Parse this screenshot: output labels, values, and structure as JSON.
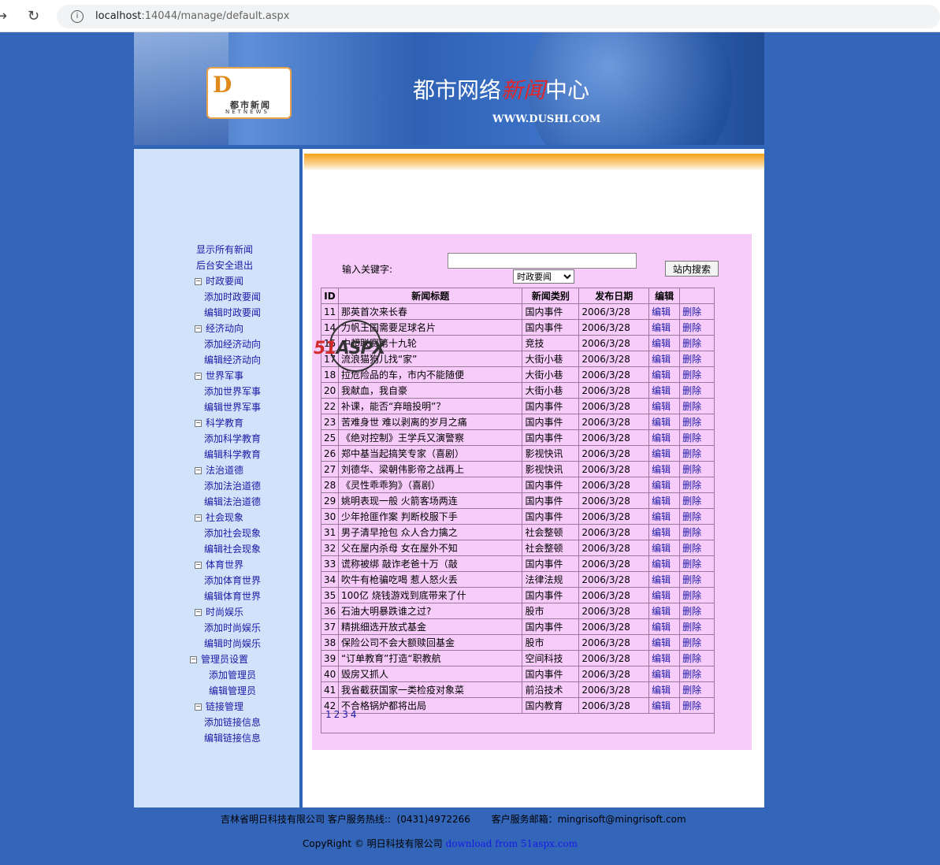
{
  "browser": {
    "url_host": "localhost",
    "url_rest": ":14044/manage/default.aspx"
  },
  "banner": {
    "logo_mark": "D",
    "logo_cn": "都市新闻",
    "logo_en": "NETNEWS",
    "title_a": "都市网络",
    "title_red": "新闻",
    "title_b": "中心",
    "site_url": "WWW.DUSHI.COM"
  },
  "sidebar": {
    "items": [
      {
        "type": "root",
        "label": "显示所有新闻"
      },
      {
        "type": "root",
        "label": "后台安全退出"
      },
      {
        "type": "group",
        "label": "时政要闻"
      },
      {
        "type": "sub",
        "label": "添加时政要闻"
      },
      {
        "type": "sub",
        "label": "编辑时政要闻"
      },
      {
        "type": "group",
        "label": "经济动向"
      },
      {
        "type": "sub",
        "label": "添加经济动向"
      },
      {
        "type": "sub",
        "label": "编辑经济动向"
      },
      {
        "type": "group",
        "label": "世界军事"
      },
      {
        "type": "sub",
        "label": "添加世界军事"
      },
      {
        "type": "sub",
        "label": "编辑世界军事"
      },
      {
        "type": "group",
        "label": "科学教育"
      },
      {
        "type": "sub",
        "label": "添加科学教育"
      },
      {
        "type": "sub",
        "label": "编辑科学教育"
      },
      {
        "type": "group",
        "label": "法治道德"
      },
      {
        "type": "sub",
        "label": "添加法治道德"
      },
      {
        "type": "sub",
        "label": "编辑法治道德"
      },
      {
        "type": "group",
        "label": "社会现象"
      },
      {
        "type": "sub",
        "label": "添加社会现象"
      },
      {
        "type": "sub",
        "label": "编辑社会现象"
      },
      {
        "type": "group",
        "label": "体育世界"
      },
      {
        "type": "sub",
        "label": "添加体育世界"
      },
      {
        "type": "sub",
        "label": "编辑体育世界"
      },
      {
        "type": "group",
        "label": "时尚娱乐"
      },
      {
        "type": "sub",
        "label": "添加时尚娱乐"
      },
      {
        "type": "sub",
        "label": "编辑时尚娱乐"
      },
      {
        "type": "admin",
        "label": "管理员设置"
      },
      {
        "type": "adminsub",
        "label": "添加管理员"
      },
      {
        "type": "adminsub",
        "label": "编辑管理员"
      },
      {
        "type": "group",
        "label": "链接管理"
      },
      {
        "type": "sub",
        "label": "添加链接信息"
      },
      {
        "type": "sub",
        "label": "编辑链接信息"
      }
    ]
  },
  "search": {
    "keyword_label": "输入关键字:",
    "keyword_value": "",
    "category_selected": "时政要闻",
    "button_label": "站内搜索"
  },
  "table": {
    "headers": [
      "ID",
      "新闻标题",
      "新闻类别",
      "发布日期",
      "编辑",
      ""
    ],
    "edit_label": "编辑",
    "delete_label": "删除",
    "rows": [
      {
        "id": "11",
        "title": "那英首次来长春",
        "cat": "国内事件",
        "date": "2006/3/28"
      },
      {
        "id": "14",
        "title": "力帆王国需要足球名片",
        "cat": "国内事件",
        "date": "2006/3/28"
      },
      {
        "id": "15",
        "title": "中超联赛第十九轮",
        "cat": "竞技",
        "date": "2006/3/28"
      },
      {
        "id": "17",
        "title": "流浪猫狗儿找“家”",
        "cat": "大街小巷",
        "date": "2006/3/28"
      },
      {
        "id": "18",
        "title": "拉危险品的车，市内不能随便",
        "cat": "大街小巷",
        "date": "2006/3/28"
      },
      {
        "id": "20",
        "title": "我献血，我自豪",
        "cat": "大街小巷",
        "date": "2006/3/28"
      },
      {
        "id": "22",
        "title": "补课，能否“弃暗投明”？",
        "cat": "国内事件",
        "date": "2006/3/28"
      },
      {
        "id": "23",
        "title": "苦难身世 难以剥离的岁月之痛",
        "cat": "国内事件",
        "date": "2006/3/28"
      },
      {
        "id": "25",
        "title": "《绝对控制》王学兵又演警察",
        "cat": "国内事件",
        "date": "2006/3/28"
      },
      {
        "id": "26",
        "title": "郑中基当起搞笑专家（喜剧）",
        "cat": "影视快讯",
        "date": "2006/3/28"
      },
      {
        "id": "27",
        "title": "刘德华、梁朝伟影帝之战再上",
        "cat": "影视快讯",
        "date": "2006/3/28"
      },
      {
        "id": "28",
        "title": "《灵性乖乖狗》（喜剧）",
        "cat": "国内事件",
        "date": "2006/3/28"
      },
      {
        "id": "29",
        "title": "姚明表现一般 火箭客场两连",
        "cat": "国内事件",
        "date": "2006/3/28"
      },
      {
        "id": "30",
        "title": "少年抢匪作案 判断校服下手",
        "cat": "国内事件",
        "date": "2006/3/28"
      },
      {
        "id": "31",
        "title": "男子清早抢包 众人合力擒之",
        "cat": "社会整顿",
        "date": "2006/3/28"
      },
      {
        "id": "32",
        "title": "父在屋内杀母 女在屋外不知",
        "cat": "社会整顿",
        "date": "2006/3/28"
      },
      {
        "id": "33",
        "title": "谎称被绑 敲诈老爸十万（敲",
        "cat": "国内事件",
        "date": "2006/3/28"
      },
      {
        "id": "34",
        "title": "吹牛有枪骗吃喝 惹人怒火丢",
        "cat": "法律法规",
        "date": "2006/3/28"
      },
      {
        "id": "35",
        "title": "100亿 烧钱游戏到底带来了什",
        "cat": "国内事件",
        "date": "2006/3/28"
      },
      {
        "id": "36",
        "title": "石油大明暴跌谁之过?",
        "cat": "股市",
        "date": "2006/3/28"
      },
      {
        "id": "37",
        "title": "精挑细选开放式基金",
        "cat": "国内事件",
        "date": "2006/3/28"
      },
      {
        "id": "38",
        "title": "保险公司不会大额赎回基金",
        "cat": "股市",
        "date": "2006/3/28"
      },
      {
        "id": "39",
        "title": "“订单教育”打造“职教航",
        "cat": "空间科技",
        "date": "2006/3/28"
      },
      {
        "id": "40",
        "title": "毁房又抓人",
        "cat": "国内事件",
        "date": "2006/3/28"
      },
      {
        "id": "41",
        "title": "我省截获国家一类检疫对象菜",
        "cat": "前沿技术",
        "date": "2006/3/28"
      },
      {
        "id": "42",
        "title": "不合格锅炉都将出局",
        "cat": "国内教育",
        "date": "2006/3/28"
      }
    ],
    "pages": [
      "1",
      "2",
      "3",
      "4"
    ]
  },
  "watermark": {
    "a": "51",
    "b": "ASPX"
  },
  "footer": {
    "line1": "吉林省明日科技有限公司 客户服务热线::  (0431)4972266       客户服务邮箱：mingrisoft@mingrisoft.com",
    "copyright": "CopyRight ©  明日科技有限公司",
    "link": "download from 51aspx.com"
  }
}
